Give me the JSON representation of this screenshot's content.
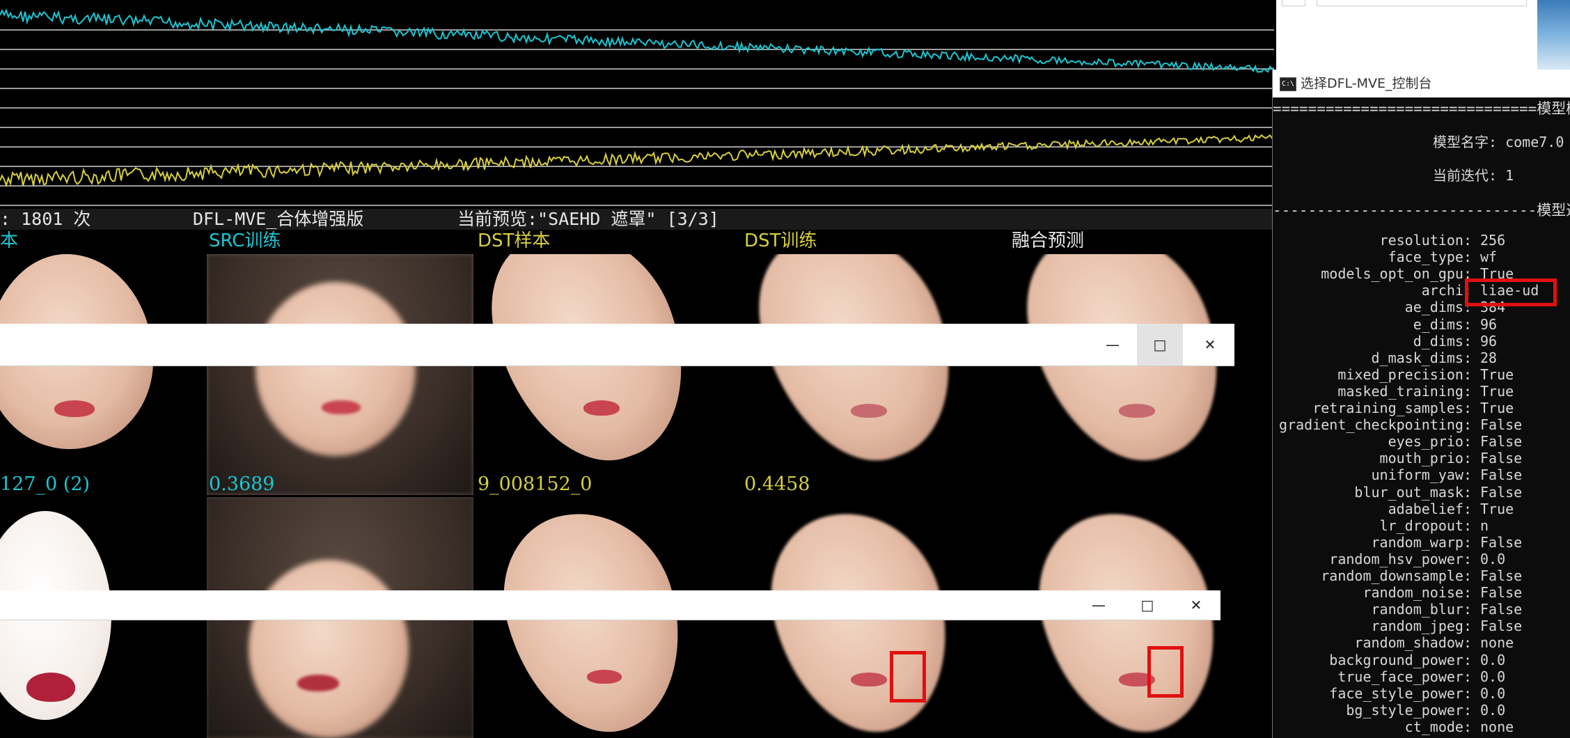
{
  "status": {
    "iter_text": ": 1801 次",
    "version": "DFL-MVE_合体增强版",
    "preview_text": "当前预览:\"SAEHD 遮罩\" [3/3]"
  },
  "columns": [
    {
      "label": "本",
      "color": "cyan"
    },
    {
      "label": "SRC训练",
      "color": "cyan"
    },
    {
      "label": "DST样本",
      "color": "yellow"
    },
    {
      "label": "DST训练",
      "color": "yellow"
    },
    {
      "label": "融合预测",
      "color": "white"
    }
  ],
  "loss_labels": [
    "127_0 (2)",
    "0.3689",
    "9_008152_0",
    "0.4458"
  ],
  "windows": {
    "minimize": "—",
    "maximize": "□",
    "close": "✕"
  },
  "console": {
    "title": "选择DFL-MVE_控制台",
    "header1": "==============================模型概",
    "model_name": "模型名字: come7.0",
    "iteration": "当前迭代: 1",
    "header2": "------------------------------模型选项",
    "options": [
      {
        "k": "resolution:",
        "v": "256"
      },
      {
        "k": "face_type:",
        "v": "wf"
      },
      {
        "k": "models_opt_on_gpu:",
        "v": "True"
      },
      {
        "k": "archi:",
        "v": "liae-ud"
      },
      {
        "k": "ae_dims:",
        "v": "384"
      },
      {
        "k": "e_dims:",
        "v": "96"
      },
      {
        "k": "d_dims:",
        "v": "96"
      },
      {
        "k": "d_mask_dims:",
        "v": "28"
      },
      {
        "k": "mixed_precision:",
        "v": "True"
      },
      {
        "k": "masked_training:",
        "v": "True"
      },
      {
        "k": "retraining_samples:",
        "v": "True"
      },
      {
        "k": "gradient_checkpointing:",
        "v": "False"
      },
      {
        "k": "eyes_prio:",
        "v": "False"
      },
      {
        "k": "mouth_prio:",
        "v": "False"
      },
      {
        "k": "uniform_yaw:",
        "v": "False"
      },
      {
        "k": "blur_out_mask:",
        "v": "False"
      },
      {
        "k": "adabelief:",
        "v": "True"
      },
      {
        "k": "lr_dropout:",
        "v": "n"
      },
      {
        "k": "random_warp:",
        "v": "False"
      },
      {
        "k": "random_hsv_power:",
        "v": "0.0"
      },
      {
        "k": "random_downsample:",
        "v": "False"
      },
      {
        "k": "random_noise:",
        "v": "False"
      },
      {
        "k": "random_blur:",
        "v": "False"
      },
      {
        "k": "random_jpeg:",
        "v": "False"
      },
      {
        "k": "random_shadow:",
        "v": "none"
      },
      {
        "k": "background_power:",
        "v": "0.0"
      },
      {
        "k": "true_face_power:",
        "v": "0.0"
      },
      {
        "k": "face_style_power:",
        "v": "0.0"
      },
      {
        "k": "bg_style_power:",
        "v": "0.0"
      },
      {
        "k": "ct_mode:",
        "v": "none"
      }
    ]
  },
  "colors": {
    "src_loss": "#19c7d2",
    "dst_loss": "#d7cf3e",
    "highlight": "#e01010"
  }
}
